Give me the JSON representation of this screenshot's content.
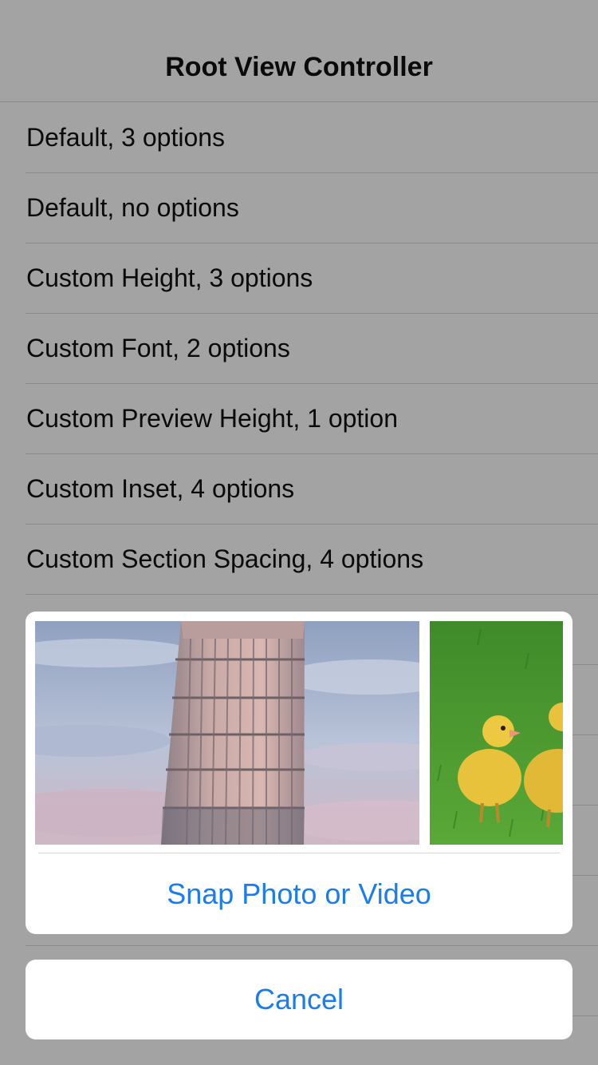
{
  "navbar": {
    "title": "Root View Controller"
  },
  "table": {
    "rows": [
      {
        "label": "Default, 3 options"
      },
      {
        "label": "Default, no options"
      },
      {
        "label": "Custom Height, 3 options"
      },
      {
        "label": "Custom Font, 2 options"
      },
      {
        "label": "Custom Preview Height, 1 option"
      },
      {
        "label": "Custom Inset, 4 options"
      },
      {
        "label": "Custom Section Spacing, 4 options"
      }
    ]
  },
  "action_sheet": {
    "photos": [
      {
        "subject": "leaning-tower-photo"
      },
      {
        "subject": "ducklings-photo"
      }
    ],
    "action_label": "Snap Photo or Video",
    "cancel_label": "Cancel"
  },
  "colors": {
    "tint": "#1b7cf0",
    "dimmed_background": "#a3a3a3",
    "card_background": "#ffffff"
  }
}
